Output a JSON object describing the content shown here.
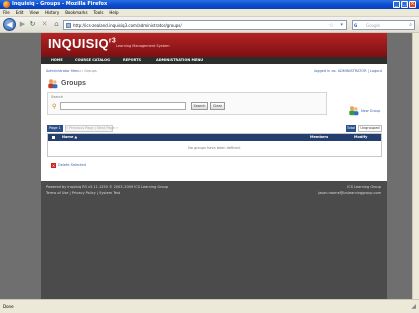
{
  "window": {
    "title": "Inquisiq - Groups - Mozilla Firefox"
  },
  "menu": [
    "File",
    "Edit",
    "View",
    "History",
    "Bookmarks",
    "Tools",
    "Help"
  ],
  "nav": {
    "url": "http://ics-zealand.inquisiq3.com/administrator/groups/",
    "search_placeholder": "Google",
    "search_engine_icon": "G"
  },
  "site": {
    "logo": "INQUISIQ",
    "logo_version": "r3",
    "tagline": "Learning Management System",
    "menu": [
      "HOME",
      "COURSE CATALOG",
      "REPORTS",
      "ADMINISTRATION MENU"
    ]
  },
  "breadcrumb": {
    "link": "Administrator Menu",
    "sep": " › ",
    "current": "Groups"
  },
  "logged_in": "logged in as: ADMINISTRATOR | Logout",
  "page": {
    "title": "Groups"
  },
  "search": {
    "label": "Search",
    "value": "",
    "search_button": "Search",
    "clear_button": "Clear"
  },
  "new_group": "New Group",
  "pager": {
    "page_label": "Page 1 of 1",
    "prev_next": "« Previous Page | Next Page »"
  },
  "tabs": {
    "total": "Total",
    "ungrouped": "Ungrouped"
  },
  "table": {
    "columns": {
      "name": "Name ▲",
      "members": "Members",
      "modify": "Modify"
    },
    "empty": "No groups have been defined."
  },
  "delete_selected": "Delete Selected",
  "footer": {
    "left1": "Powered by Inquisiq R3 v3.11.1250 © 2003–2009 ICS Learning Group",
    "left2": "Terms of Use | Privacy Policy | System Test",
    "right1": "ICS Learning Group",
    "right2": "jason.roome@icslearninggroup.com"
  },
  "status": "Done",
  "colors": {
    "brand": "#9b1a1c",
    "nav_dark": "#2d2d2d",
    "grid_header": "#243e6e",
    "link": "#3a62b0"
  }
}
